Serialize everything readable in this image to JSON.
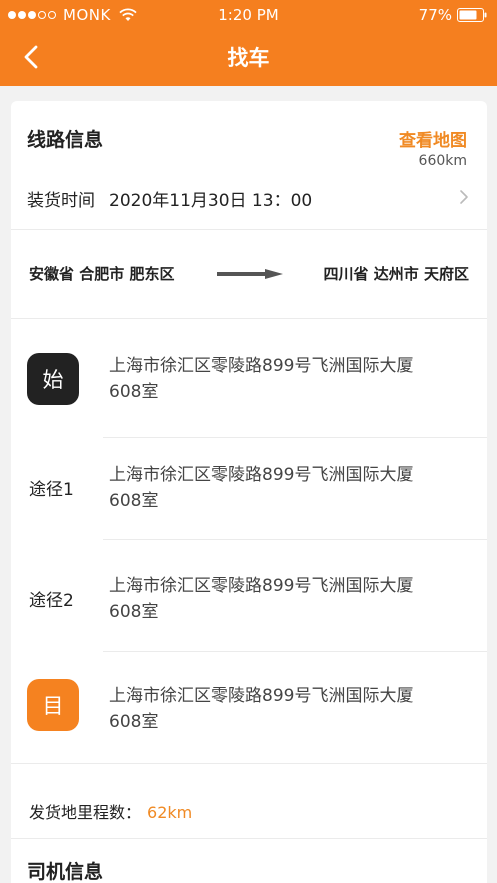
{
  "status_bar": {
    "carrier": "MONK",
    "time": "1:20 PM",
    "battery": "77%"
  },
  "nav": {
    "title": "找车"
  },
  "route_info": {
    "title": "线路信息",
    "view_map_label": "查看地图",
    "distance": "660km",
    "load_time_label": "装货时间",
    "load_time_value": "2020年11月30日   13：00",
    "from": "安徽省 合肥市 肥东区",
    "to": "四川省 达州市 天府区"
  },
  "stops": [
    {
      "badge": "始",
      "address": "上海市徐汇区零陵路899号飞洲国际大厦608室"
    },
    {
      "label": "途径1",
      "address": "上海市徐汇区零陵路899号飞洲国际大厦608室"
    },
    {
      "label": "途径2",
      "address": "上海市徐汇区零陵路899号飞洲国际大厦608室"
    },
    {
      "badge": "目",
      "address": "上海市徐汇区零陵路899号飞洲国际大厦608室"
    }
  ],
  "mileage": {
    "label": "发货地里程数：",
    "value": "62km"
  },
  "driver_info": {
    "title": "司机信息"
  },
  "colors": {
    "accent": "#f57f1f",
    "link": "#f08a24",
    "start_badge": "#222222",
    "end_badge": "#f58220"
  }
}
